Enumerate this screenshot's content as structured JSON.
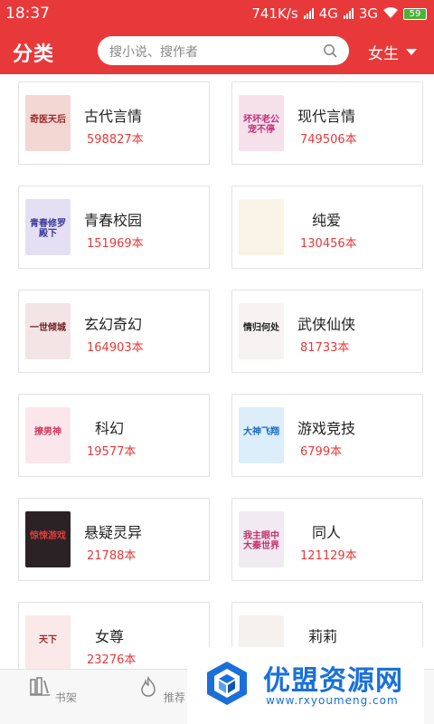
{
  "status_bar": {
    "time": "18:37",
    "speed": "741K/s",
    "net1": "4G",
    "net2": "3G",
    "battery": "59"
  },
  "header": {
    "title": "分类",
    "search_placeholder": "搜小说、搜作者",
    "gender": "女生"
  },
  "categories": [
    {
      "name": "古代言情",
      "count": "598827本",
      "cover_text": "奇医天后",
      "cover_color": "#f2d7d3",
      "cover_ink": "#9a2a2a"
    },
    {
      "name": "现代言情",
      "count": "749506本",
      "cover_text": "坏坏老公宠不停",
      "cover_color": "#f6e1ea",
      "cover_ink": "#c0307a"
    },
    {
      "name": "青春校园",
      "count": "151969本",
      "cover_text": "青春修罗殿下",
      "cover_color": "#e4dff3",
      "cover_ink": "#3a3a9a"
    },
    {
      "name": "纯爱",
      "count": "130456本",
      "cover_text": "",
      "cover_color": "#faf4e6",
      "cover_ink": "#b38a3a"
    },
    {
      "name": "玄幻奇幻",
      "count": "164903本",
      "cover_text": "一世倾城",
      "cover_color": "#f3e4e6",
      "cover_ink": "#6a1a1a"
    },
    {
      "name": "武侠仙侠",
      "count": "81733本",
      "cover_text": "情归何处",
      "cover_color": "#f7f3f3",
      "cover_ink": "#222222"
    },
    {
      "name": "科幻",
      "count": "19577本",
      "cover_text": "撩男神",
      "cover_color": "#fbe6ec",
      "cover_ink": "#d43a5a"
    },
    {
      "name": "游戏竞技",
      "count": "6799本",
      "cover_text": "大神飞翔",
      "cover_color": "#dceefa",
      "cover_ink": "#1a6ac0"
    },
    {
      "name": "悬疑灵异",
      "count": "21788本",
      "cover_text": "惊悚游戏",
      "cover_color": "#2a2224",
      "cover_ink": "#e23a3a"
    },
    {
      "name": "同人",
      "count": "121129本",
      "cover_text": "我主眼中大秦世界",
      "cover_color": "#f1eaf3",
      "cover_ink": "#c0306a"
    },
    {
      "name": "女尊",
      "count": "23276本",
      "cover_text": "天下",
      "cover_color": "#fbe9ea",
      "cover_ink": "#a02a2a"
    },
    {
      "name": "莉莉",
      "count": "",
      "cover_text": "",
      "cover_color": "#f7f1ee",
      "cover_ink": "#c04a4a"
    }
  ],
  "bottom_tabs": [
    {
      "label": "书架",
      "icon": "bookshelf-icon"
    },
    {
      "label": "推荐",
      "icon": "flame-icon"
    }
  ],
  "watermark": {
    "title": "优盟资源网",
    "url": "www.rxyoumeng.com"
  },
  "colors": {
    "brand_red": "#e8393a",
    "watermark_blue": "#1a70d8"
  }
}
